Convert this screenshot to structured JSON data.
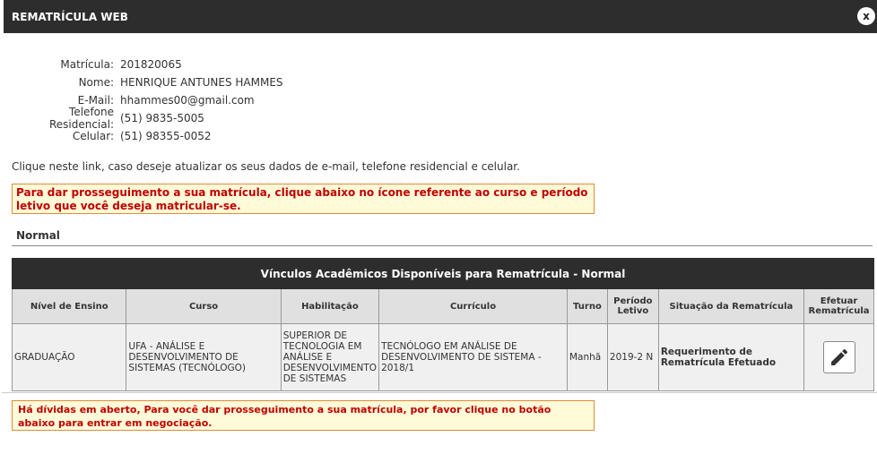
{
  "window": {
    "title": "REMATRÍCULA WEB",
    "close_label": "x"
  },
  "student": [
    {
      "label": "Matrícula:",
      "value": "201820065"
    },
    {
      "label": "Nome:",
      "value": "HENRIQUE ANTUNES HAMMES"
    },
    {
      "label": "E-Mail:",
      "value": "hhammes00@gmail.com"
    },
    {
      "label": "Telefone Residencial:",
      "value": "(51) 9835-5005"
    },
    {
      "label": "Celular:",
      "value": "(51) 98355-0052"
    }
  ],
  "update_link": "Clique neste link, caso deseje atualizar os seus dados de e-mail, telefone residencial e celular.",
  "alert_main": "Para dar prosseguimento a sua matrícula, clique abaixo no ícone referente ao curso e período letivo que você deseja matricular-se.",
  "section": {
    "title": "Normal"
  },
  "table": {
    "caption": "Vínculos Acadêmicos Disponíveis para Rematrícula - Normal",
    "headers": [
      "Nível de Ensino",
      "Curso",
      "Habilitação",
      "Currículo",
      "Turno",
      "Período Letivo",
      "Situação da Rematrícula",
      "Efetuar Rematrícula"
    ],
    "rows": [
      {
        "nivel": "GRADUAÇÃO",
        "curso": "UFA - ANÁLISE E DESENVOLVIMENTO DE SISTEMAS (TECNÓLOGO)",
        "habilitacao": "SUPERIOR DE TECNOLOGIA EM ANÁLISE E DESENVOLVIMENTO DE SISTEMAS",
        "curriculo": "TECNÓLOGO EM ANÁLISE DE DESENVOLVIMENTO DE SISTEMA - 2018/1",
        "turno": "Manhã",
        "periodo": "2019-2 N",
        "situacao": "Requerimento de Rematrícula Efetuado",
        "action_icon": "pencil-icon"
      }
    ]
  },
  "alert_debt": "Há dívidas em aberto, Para você dar prosseguimento a sua matrícula, por favor clique no botão abaixo para entrar em negociação."
}
